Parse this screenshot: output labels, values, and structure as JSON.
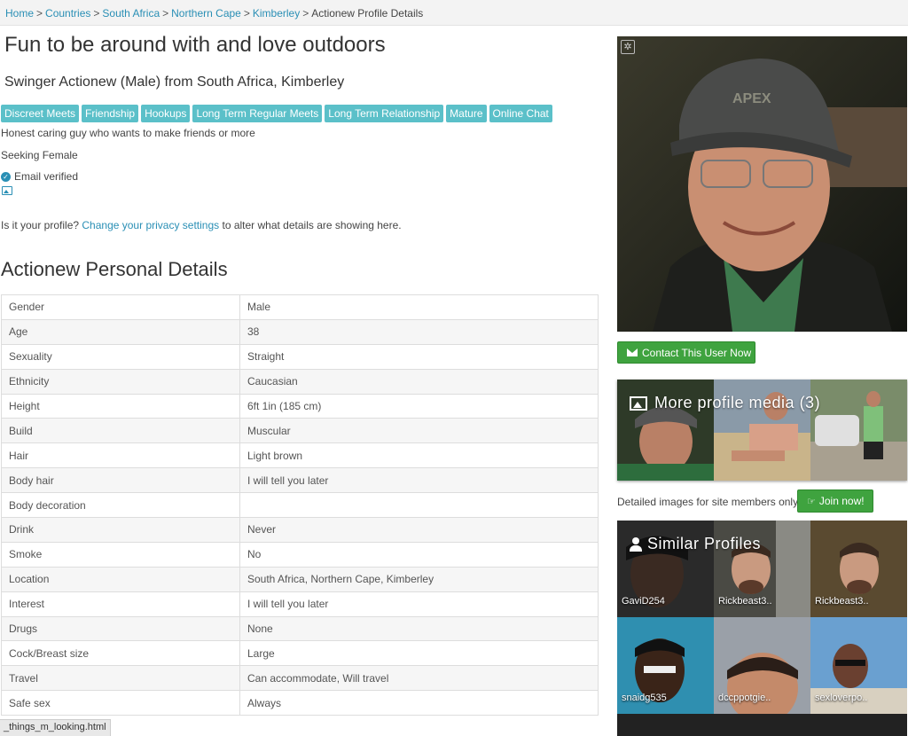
{
  "breadcrumb": {
    "items": [
      "Home",
      "Countries",
      "South Africa",
      "Northern Cape",
      "Kimberley"
    ],
    "separator": ">",
    "current": "Actionew Profile Details"
  },
  "profile": {
    "title": "Fun to be around with and love outdoors",
    "subtitle": "Swinger Actionew (Male) from South Africa, Kimberley",
    "tags": [
      "Discreet Meets",
      "Friendship",
      "Hookups",
      "Long Term Regular Meets",
      "Long Term Relationship",
      "Mature",
      "Online Chat"
    ],
    "description": "Honest caring guy who wants to make friends or more",
    "seeking": "Seeking Female",
    "email_verified": "Email verified"
  },
  "privacy": {
    "prefix": "Is it your profile?",
    "link": "Change your privacy settings",
    "suffix": "to alter what details are showing here."
  },
  "details": {
    "heading": "Actionew Personal Details",
    "rows": [
      [
        "Gender",
        "Male"
      ],
      [
        "Age",
        "38"
      ],
      [
        "Sexuality",
        "Straight"
      ],
      [
        "Ethnicity",
        "Caucasian"
      ],
      [
        "Height",
        "6ft 1in (185 cm)"
      ],
      [
        "Build",
        "Muscular"
      ],
      [
        "Hair",
        "Light brown"
      ],
      [
        "Body hair",
        "I will tell you later"
      ],
      [
        "Body decoration",
        ""
      ],
      [
        "Drink",
        "Never"
      ],
      [
        "Smoke",
        "No"
      ],
      [
        "Location",
        "South Africa, Northern Cape, Kimberley"
      ],
      [
        "Interest",
        "I will tell you later"
      ],
      [
        "Drugs",
        "None"
      ],
      [
        "Cock/Breast size",
        "Large"
      ],
      [
        "Travel",
        "Can accommodate, Will travel"
      ],
      [
        "Safe sex",
        "Always"
      ]
    ]
  },
  "sidebar": {
    "contact_label": "Contact This User Now",
    "media_title": "More profile media (3)",
    "members_only": "Detailed images for site members only",
    "join_label": "Join now!",
    "similar_title": "Similar Profiles",
    "similar_profiles": [
      "GaviD254",
      "Rickbeast3..",
      "Rickbeast3..",
      "snaidg535",
      "dccppotgie..",
      "sexloverpo.."
    ]
  },
  "statusbar": {
    "url": "_things_m_looking.html"
  },
  "colors": {
    "link": "#2a8fb5",
    "tag_bg": "#5bc0c9",
    "button_green": "#3fa33f"
  }
}
